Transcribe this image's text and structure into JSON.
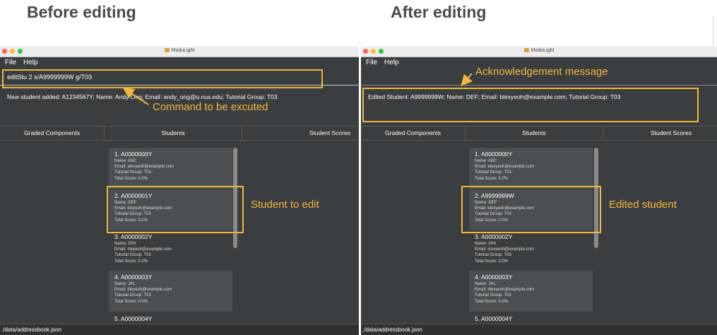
{
  "headings": {
    "before": "Before editing",
    "after": "After editing"
  },
  "app": {
    "title": "ModuLight",
    "menu": [
      "File",
      "Help"
    ],
    "tabs": [
      "Graded Components",
      "Students",
      "Student Scores"
    ],
    "status_path": "./data/addressbook.json"
  },
  "before": {
    "command": "editStu 2 s/A9999999W g/T03",
    "result": "New student added: A1234567Y; Name: Andy Ong; Email: andy_ong@u.nus.edu; Tutorial Group: T03",
    "students": [
      {
        "id": "1.  A0000000Y",
        "name": "Name: ABC",
        "email": "Email: alexyeoh@example.com",
        "group": "Tutorial Group: T03",
        "score": "Total Score: 0.0%"
      },
      {
        "id": "2.  A0000001Y",
        "name": "Name: DEF",
        "email": "Email: bleyeoh@example.com",
        "group": "Tutorial Group: T03",
        "score": "Total Score: 0.0%"
      },
      {
        "id": "3.  A0000002Y",
        "name": "Name: GHI",
        "email": "Email: cleyeoh@example.com",
        "group": "Tutorial Group: T03",
        "score": "Total Score: 0.0%"
      },
      {
        "id": "4.  A0000003Y",
        "name": "Name: JKL",
        "email": "Email: dleyeoh@example.com",
        "group": "Tutorial Group: T03",
        "score": "Total Score: 0.0%"
      },
      {
        "id": "5.  A0000004Y"
      }
    ]
  },
  "after": {
    "result": "Edited Student: A9999999W; Name: DEF; Email: blexyeoh@example.com; Tutorial Group: T03",
    "students": [
      {
        "id": "1.  A0000000Y",
        "name": "Name: ABC",
        "email": "Email: alexyeoh@example.com",
        "group": "Tutorial Group: T03",
        "score": "Total Score: 0.0%"
      },
      {
        "id": "2.  A9999999W",
        "name": "Name: DEF",
        "email": "Email: blexyeoh@example.com",
        "group": "Tutorial Group: T03",
        "score": "Total Score: 0.0%"
      },
      {
        "id": "3.  A0000002Y",
        "name": "Name: GHI",
        "email": "Email: cloxyeoh@example.com",
        "group": "Tutorial Group: T03",
        "score": "Total Score: 0.0%"
      },
      {
        "id": "4.  A0000003Y",
        "name": "Name: JKL",
        "email": "Email: dlexyeoh@example.com",
        "group": "Tutorial Group: T03",
        "score": "Total Score: 0.0%"
      },
      {
        "id": "5.  A0000004Y"
      }
    ]
  },
  "annotations": {
    "command": "Command to be excuted",
    "student_to_edit": "Student to edit",
    "acknowledgement": "Acknowledgement message",
    "edited_student": "Edited student"
  },
  "colors": {
    "highlight": "#f2b73a",
    "window_bg": "#3b3e40",
    "card_dark": "#4b4f52"
  }
}
